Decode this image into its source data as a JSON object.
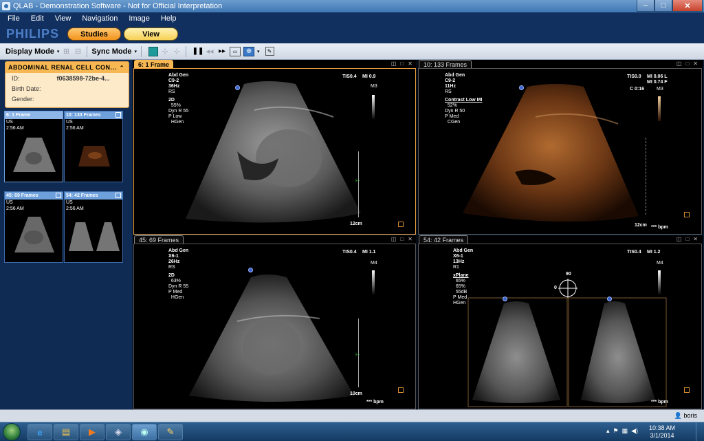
{
  "window": {
    "title": "QLAB - Demonstration Software - Not for Official Interpretation",
    "controls": {
      "minimize": "–",
      "maximize": "□",
      "close": "✕"
    }
  },
  "menu": [
    "File",
    "Edit",
    "View",
    "Navigation",
    "Image",
    "Help"
  ],
  "brand": {
    "logo": "PHILIPS"
  },
  "main_buttons": {
    "studies": "Studies",
    "view": "View"
  },
  "toolbar": {
    "display_mode": "Display Mode",
    "sync_mode": "Sync Mode",
    "dropdown": "▾",
    "pause": "❚❚",
    "forward": "▸▸",
    "back": "◂◂"
  },
  "patient": {
    "title": "ABDOMINAL RENAL CELL CON...",
    "collapse": "⌃",
    "fields": [
      {
        "label": "ID:",
        "value": "f0638598-72be-4..."
      },
      {
        "label": "Birth Date:",
        "value": ""
      },
      {
        "label": "Gender:",
        "value": ""
      }
    ]
  },
  "thumbnails": [
    {
      "title": "6: 1 Frame",
      "modality": "US",
      "time": "2:56 AM"
    },
    {
      "title": "10: 133 Frames",
      "modality": "US",
      "time": "2:56 AM"
    },
    {
      "title": "45: 69 Frames",
      "modality": "US",
      "time": "2:56 AM"
    },
    {
      "title": "54: 42 Frames",
      "modality": "US",
      "time": "2:56 AM"
    }
  ],
  "viewports": [
    {
      "tab": "6: 1 Frame",
      "preset": "Abd Gen",
      "probe": "C9-2",
      "rate": "36Hz",
      "mode": "RS",
      "params": [
        "2D",
        "  55%",
        "Dyn R 55",
        "P Low",
        "  HGen"
      ],
      "tis": "TIS0.4",
      "mi": "MI 0.9",
      "map": "M3",
      "depth": "12cm",
      "bpm": ""
    },
    {
      "tab": "10: 133 Frames",
      "preset": "Abd Gen",
      "probe": "C9-2",
      "rate": "11Hz",
      "mode": "RS",
      "params": [
        "Contrast Low MI",
        "  52%",
        "Dyn R 50",
        "P Med",
        "  CGen"
      ],
      "tis": "TIS0.0",
      "mi": "MI 0.06 L",
      "mi2": "MI 0.74 F",
      "contrast": "C 0:16",
      "map": "M3",
      "depth": "12cm",
      "bpm": "*** bpm"
    },
    {
      "tab": "45: 69 Frames",
      "preset": "Abd Gen",
      "probe": "X6-1",
      "rate": "26Hz",
      "mode": "RS",
      "params": [
        "2D",
        "  63%",
        "Dyn R 55",
        "P Med",
        "  HGen"
      ],
      "tis": "TIS0.4",
      "mi": "MI 1.1",
      "map": "M4",
      "depth": "10cm",
      "bpm": "*** bpm"
    },
    {
      "tab": "54: 42 Frames",
      "preset": "Abd Gen",
      "probe": "X6-1",
      "rate": "13Hz",
      "mode": "R1",
      "params": [
        "xPlane",
        "  65%",
        "  65%",
        "  55dB",
        "P Med",
        "HGen"
      ],
      "tis": "TIS0.4",
      "mi": "MI 1.2",
      "map": "M4",
      "angle_top": "90",
      "angle_left": "0",
      "bpm": "*** bpm"
    }
  ],
  "viewport_controls": [
    "◫",
    "□",
    "✕"
  ],
  "status": {
    "user": "boris"
  },
  "taskbar": {
    "time": "10:38 AM",
    "date": "3/1/2014"
  }
}
